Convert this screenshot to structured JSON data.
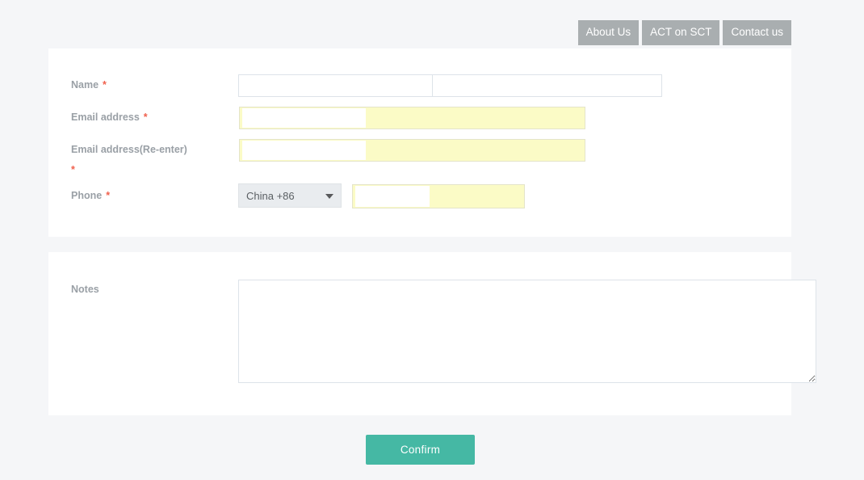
{
  "nav": {
    "tabs": [
      {
        "label": "About Us"
      },
      {
        "label": "ACT on SCT"
      },
      {
        "label": "Contact us"
      }
    ]
  },
  "colors": {
    "page_background": "#f5f6f8",
    "card_background": "#ffffff",
    "nav_tab_background": "#a9aeb0",
    "nav_tab_text": "#ffffff",
    "label_text": "#9aa0a6",
    "required_asterisk": "#f0604d",
    "input_border": "#dde3e9",
    "autofill_background": "#fbfbc6",
    "select_background": "#e9ecef",
    "confirm_button": "#45b8a4"
  },
  "form": {
    "name": {
      "label": "Name",
      "required_mark": "*",
      "first_value": "",
      "first_placeholder": "",
      "last_value": "",
      "last_placeholder": ""
    },
    "email": {
      "label": "Email address",
      "required_mark": "*",
      "value": "",
      "placeholder": "",
      "autofilled": true
    },
    "email_reenter": {
      "label": "Email address(Re-enter)",
      "required_mark": "*",
      "value": "",
      "placeholder": "",
      "autofilled": true
    },
    "phone": {
      "label": "Phone",
      "required_mark": "*",
      "country_selected": "China +86",
      "country_options": [
        "China +86"
      ],
      "value": "",
      "placeholder": "",
      "autofilled": true
    },
    "notes": {
      "label": "Notes",
      "value": "",
      "placeholder": ""
    }
  },
  "actions": {
    "confirm_label": "Confirm"
  }
}
